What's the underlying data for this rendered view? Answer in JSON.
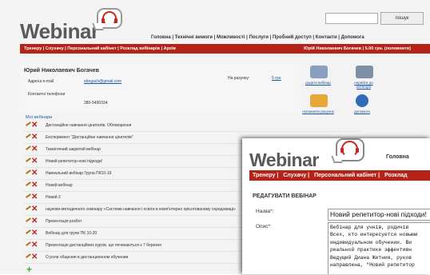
{
  "background": {
    "logo": "Webinar",
    "search_button": "пошук",
    "top_nav": "Головна | Технічні вимоги | Можливості | Послуги | Пробний доступ | Контакти | Допомога",
    "red_nav_left": "Тренеру | Слухачу | Персональний кабінет | Розклад вебінарів | Архів",
    "red_nav_right": "Юрій Николаевич Богачев | 5.00 грн. (поповнити)",
    "profile": {
      "name": "Юрий Николаевич Богачев",
      "email_label": "Адреса e-mail",
      "email_value": "ebogach@gmail.com",
      "phone_label": "Контактні телефони",
      "phone_value": "380-5490334",
      "balance_label": "На рахунку:",
      "balance_value": "5 грн"
    },
    "tiles": [
      {
        "label": "додати вебінар",
        "color": "#8a9fc0"
      },
      {
        "label": "перейти до категорії",
        "color": "#7f8fa5"
      },
      {
        "label": "поповнити рахунок",
        "color": "#e6a63a"
      },
      {
        "label": "допомога",
        "color": "#2f6bb8"
      }
    ],
    "list_title": "Мої вебінари",
    "webinars": [
      "Дистанційне навчання цінителів. Обговорення",
      "Експеримент \"Дистанційне навчання цінителів\"",
      "Тематичний закритий вебінар",
      "Новий репетитор-нові підходи!",
      "Навчальний вебінар Група ПК10-19",
      "Новий вебінар",
      "Новий 2",
      "науково-методичного семінару «Системи навчання і освіти в комп'ютерно орієнтованому середовищі»",
      "Презентація розбот",
      "Вебінар для групи ПК 10-20",
      "Презентація дистанційних курсів, що починаються з 7 березня",
      "О роли общения в дистанционном обучении"
    ]
  },
  "window": {
    "logo": "Webinar",
    "top_nav": "Головна",
    "red_nav": [
      "Тренеру",
      "Слухачу",
      "Персональний кабінет",
      "Розклад"
    ],
    "page_title": "РЕДАГУВАТИ ВЕБІНАР",
    "name_label": "Назва*:",
    "name_value": "Новий репетитор-нові підходи!",
    "desc_label": "Опис*:",
    "desc_lines": [
      "Вебінар для учнів, родичів",
      "Всех, кто интересуется новыми",
      "индивидуальном обучении. Ви",
      "реальной практике эффективн",
      "Ведущий Диана Житния, руков",
      "направлена, \"Новий репетитор"
    ]
  }
}
